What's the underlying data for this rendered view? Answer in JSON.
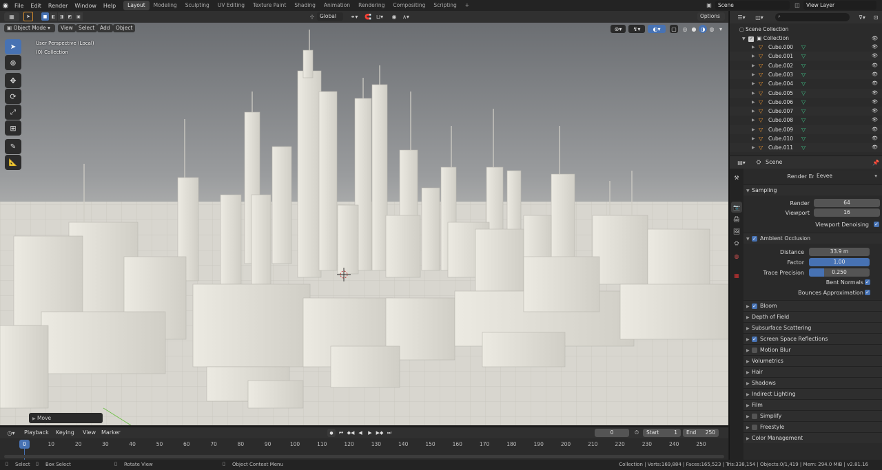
{
  "menubar": {
    "menus": [
      "File",
      "Edit",
      "Render",
      "Window",
      "Help"
    ],
    "workspaces": [
      "Layout",
      "Modeling",
      "Sculpting",
      "UV Editing",
      "Texture Paint",
      "Shading",
      "Animation",
      "Rendering",
      "Compositing",
      "Scripting"
    ],
    "active_workspace": "Layout",
    "add_tab": "+",
    "scene": "Scene",
    "view_layer": "View Layer"
  },
  "tool_header": {
    "orientation": "Global",
    "options": "Options"
  },
  "viewport_header": {
    "mode": "Object Mode",
    "menus": [
      "View",
      "Select",
      "Add",
      "Object"
    ]
  },
  "viewport": {
    "overlay_line1": "User Perspective (Local)",
    "overlay_line2": "(0) Collection",
    "last_op": "Move"
  },
  "outliner": {
    "root": "Scene Collection",
    "collection": "Collection",
    "items": [
      "Cube.000",
      "Cube.001",
      "Cube.002",
      "Cube.003",
      "Cube.004",
      "Cube.005",
      "Cube.006",
      "Cube.007",
      "Cube.008",
      "Cube.009",
      "Cube.010",
      "Cube.011"
    ]
  },
  "properties": {
    "context": "Scene",
    "render_engine_label": "Render Engine",
    "render_engine": "Eevee",
    "sampling": {
      "title": "Sampling",
      "render_label": "Render",
      "render": "64",
      "viewport_label": "Viewport",
      "viewport": "16",
      "denoise_label": "Viewport Denoising"
    },
    "ao": {
      "title": "Ambient Occlusion",
      "distance_label": "Distance",
      "distance": "33.9 m",
      "factor_label": "Factor",
      "factor": "1.00",
      "trace_label": "Trace Precision",
      "trace": "0.250",
      "bent_label": "Bent Normals",
      "bounce_label": "Bounces Approximation"
    },
    "sections": [
      {
        "label": "Bloom",
        "checkbox": true,
        "checked": true
      },
      {
        "label": "Depth of Field",
        "checkbox": false
      },
      {
        "label": "Subsurface Scattering",
        "checkbox": false
      },
      {
        "label": "Screen Space Reflections",
        "checkbox": true,
        "checked": true
      },
      {
        "label": "Motion Blur",
        "checkbox": true,
        "checked": false
      },
      {
        "label": "Volumetrics",
        "checkbox": false
      },
      {
        "label": "Hair",
        "checkbox": false
      },
      {
        "label": "Shadows",
        "checkbox": false
      },
      {
        "label": "Indirect Lighting",
        "checkbox": false
      },
      {
        "label": "Film",
        "checkbox": false
      },
      {
        "label": "Simplify",
        "checkbox": true,
        "checked": false
      },
      {
        "label": "Freestyle",
        "checkbox": true,
        "checked": false
      },
      {
        "label": "Color Management",
        "checkbox": false
      }
    ]
  },
  "timeline": {
    "menus": [
      "Playback",
      "Keying",
      "View",
      "Marker"
    ],
    "current_frame": "0",
    "start_label": "Start",
    "start": "1",
    "end_label": "End",
    "end": "250",
    "ticks": [
      "0",
      "10",
      "20",
      "30",
      "40",
      "50",
      "60",
      "70",
      "80",
      "90",
      "100",
      "110",
      "120",
      "130",
      "140",
      "150",
      "160",
      "170",
      "180",
      "190",
      "200",
      "210",
      "220",
      "230",
      "240",
      "250"
    ],
    "playhead": "0"
  },
  "statusbar": {
    "select": "Select",
    "box_select": "Box Select",
    "rotate_view": "Rotate View",
    "context_menu": "Object Context Menu",
    "stats": "Collection | Verts:169,884 | Faces:165,523 | Tris:338,154 | Objects:0/1,419 | Mem: 294.0 MiB | v2.81.16"
  },
  "colors": {
    "accent": "#4772b3",
    "mesh_orange": "#e8922e",
    "mesh_green": "#3fc98a"
  }
}
